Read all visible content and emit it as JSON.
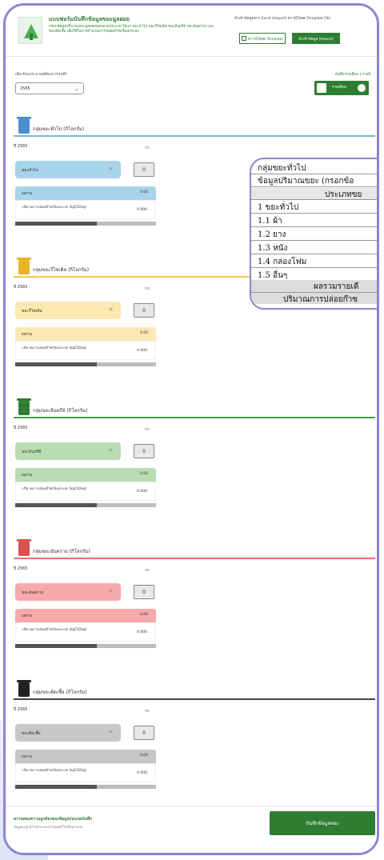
{
  "header": {
    "title": "แบบฟอร์มบันทึกข้อมูลขยะมูลฝอย",
    "subtitle": "กรอกข้อมูลปริมาณขยะมูลฝอยแยกตามประเภท ได้แก่ ขยะทั่วไป ขยะรีไซเคิล ขยะอินทรีย์ ขยะอันตราย และขยะติดเชื้อ เพื่อใช้ในการคำนวณการปล่อยก๊าซเรือนกระจก",
    "import_label": "นำเข้าข้อมูลจาก Excel (Import) ดาวน์โหลด Template File",
    "template_button": "ดาวน์โหลด Template",
    "import_button": "นำเข้าข้อมูล (Import)"
  },
  "toolbar": {
    "filter_label": "เลือกปีงบประมาณที่ต้องการบันทึก",
    "year_value": "2565",
    "link_right": "บันทึกรายเดือน | รายปี",
    "toggle_label": "รายเดือน"
  },
  "sections": [
    {
      "title": "กลุ่มขยะทั่วไป (กิโลกรัม)",
      "year": "ปี 2565",
      "unit": "กก.",
      "field": "ขยะทั่วไป",
      "qty": "0",
      "sum_label": "ผลรวม",
      "sum_value": "0.00",
      "ghg_label": "ปริมาณการปล่อยก๊าซเรือนกระจก (kgCO2eq)",
      "ghg_value": "0.000",
      "progress": 0.58,
      "color": "#a8d4ea",
      "line": "#7cb6d6",
      "bin": "#4a8fcf"
    },
    {
      "title": "กลุ่มขยะรีไซเคิล (กิโลกรัม)",
      "year": "ปี 2565",
      "unit": "กก.",
      "field": "ขยะรีไซเคิล",
      "qty": "0",
      "sum_label": "ผลรวม",
      "sum_value": "0.00",
      "ghg_label": "ปริมาณการปล่อยก๊าซเรือนกระจก (kgCO2eq)",
      "ghg_value": "0.000",
      "progress": 0.58,
      "color": "#fbe8b2",
      "line": "#f2c94c",
      "bin": "#e6b422"
    },
    {
      "title": "กลุ่มขยะอินทรีย์ (กิโลกรัม)",
      "year": "ปี 2565",
      "unit": "กก.",
      "field": "ขยะอินทรีย์",
      "qty": "0",
      "sum_label": "ผลรวม",
      "sum_value": "0.00",
      "ghg_label": "ปริมาณการปล่อยก๊าซเรือนกระจก (kgCO2eq)",
      "ghg_value": "0.000",
      "progress": 0.58,
      "color": "#b9dcb3",
      "line": "#43a047",
      "bin": "#2e7d32"
    },
    {
      "title": "กลุ่มขยะอันตราย (กิโลกรัม)",
      "year": "ปี 2565",
      "unit": "กก.",
      "field": "ขยะอันตราย",
      "qty": "0",
      "sum_label": "ผลรวม",
      "sum_value": "0.00",
      "ghg_label": "ปริมาณการปล่อยก๊าซเรือนกระจก (kgCO2eq)",
      "ghg_value": "0.000",
      "progress": 0.58,
      "color": "#f6a9a9",
      "line": "#e57373",
      "bin": "#d9534f"
    },
    {
      "title": "กลุ่มขยะติดเชื้อ (กิโลกรัม)",
      "year": "ปี 2565",
      "unit": "กก.",
      "field": "ขยะติดเชื้อ",
      "qty": "0",
      "sum_label": "ผลรวม",
      "sum_value": "0.00",
      "ghg_label": "ปริมาณการปล่อยก๊าซเรือนกระจก (kgCO2eq)",
      "ghg_value": "0.000",
      "progress": 0.58,
      "color": "#c7c7c7",
      "line": "#444444",
      "bin": "#222222"
    }
  ],
  "popup": {
    "title": "กลุ่มขยะทั่วไป",
    "subtitle": "ข้อมูลปริมาณขยะ (กรอกข้อ",
    "column_header": "ประเภทขย",
    "items": [
      "1 ขยะทั่วไป",
      "1.1 ผ้า",
      "1.2 ยาง",
      "1.3 หนัง",
      "1.4 กล่องโฟม",
      "1.5 อื่นๆ"
    ],
    "total_label": "ผลรวมรายเดื",
    "ghg_label": "ปริมาณการปล่อยก๊าซ"
  },
  "footer": {
    "title": "ตรวจสอบความถูกต้องของข้อมูลก่อนกดบันทึก",
    "subtitle": "ข้อมูลจะถูกนำไปคำนวณการปล่อยก๊าซเรือนกระจก",
    "save_button": "บันทึกข้อมูลขยะ"
  }
}
